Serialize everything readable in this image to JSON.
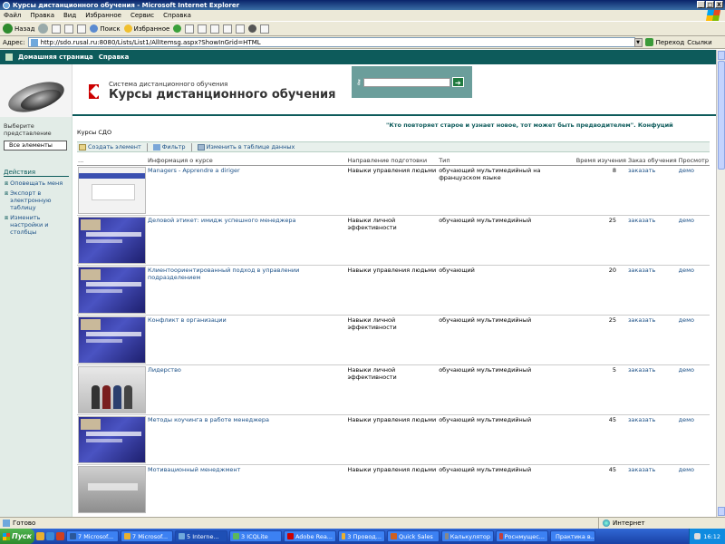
{
  "window": {
    "title": "Курсы дистанционного обучения - Microsoft Internet Explorer",
    "minimize": "_",
    "maximize": "□",
    "close": "X"
  },
  "menubar": [
    "Файл",
    "Правка",
    "Вид",
    "Избранное",
    "Сервис",
    "Справка"
  ],
  "toolbar": {
    "back": "Назад",
    "search": "Поиск",
    "favorites": "Избранное"
  },
  "addressbar": {
    "label": "Адрес:",
    "url": "http://sdo.rusal.ru:8080/Lists/List1/AllItemsg.aspx?ShowInGrid=HTML",
    "go": "Переход",
    "links": "Ссылки"
  },
  "sp": {
    "home": "Домашняя страница",
    "help": "Справка",
    "site_small": "Система дистанционного обучения",
    "site_big": "Курсы дистанционного обучения",
    "search_go": "➔",
    "quote": "\"Кто повторяет старое и узнает новое, тот может быть предводителем\". Конфуций"
  },
  "leftnav": {
    "choose_view": "Выберите представление",
    "current_view": "Все элементы",
    "actions_header": "Действия",
    "actions": [
      "Оповещать меня",
      "Экспорт в электронную таблицу",
      "Изменить настройки и столбцы"
    ]
  },
  "list": {
    "title": "Курсы СДО",
    "toolbar": {
      "new_item": "Создать элемент",
      "filter": "Фильтр",
      "edit_grid": "Изменить в таблице данных"
    },
    "headers": [
      "...",
      "Информация о курсе",
      "Направление подготовки",
      "Тип",
      "Время изучения",
      "Заказ обучения",
      "Просмотр"
    ],
    "rows": [
      {
        "thumb": "white",
        "name": "Managers - Apprendre a diriger",
        "direction": "Навыки управления людьми",
        "type": "обучающий мультимедийный на французском языке",
        "time": "8",
        "order": "заказать",
        "view": "демо"
      },
      {
        "thumb": "blue",
        "name": "Деловой этикет: имидж успешного менеджера",
        "direction": "Навыки личной эффективности",
        "type": "обучающий мультимедийный",
        "time": "25",
        "order": "заказать",
        "view": "демо"
      },
      {
        "thumb": "blue",
        "name": "Клиентоориентированный подход в управлении подразделением",
        "direction": "Навыки управления людьми",
        "type": "обучающий",
        "time": "20",
        "order": "заказать",
        "view": "демо"
      },
      {
        "thumb": "blue",
        "name": "Конфликт в организации",
        "direction": "Навыки личной эффективности",
        "type": "обучающий мультимедийный",
        "time": "25",
        "order": "заказать",
        "view": "демо"
      },
      {
        "thumb": "people",
        "name": "Лидерство",
        "direction": "Навыки личной эффективности",
        "type": "обучающий мультимедийный",
        "time": "5",
        "order": "заказать",
        "view": "демо"
      },
      {
        "thumb": "blue",
        "name": "Методы коучинга в работе менеджера",
        "direction": "Навыки управления людьми",
        "type": "обучающий мультимедийный",
        "time": "45",
        "order": "заказать",
        "view": "демо"
      },
      {
        "thumb": "gray",
        "name": "Мотивационный менеджмент",
        "direction": "Навыки управления людьми",
        "type": "обучающий мультимедийный",
        "time": "45",
        "order": "заказать",
        "view": "демо"
      }
    ]
  },
  "statusbar": {
    "left": "Готово",
    "zone": "Интернет"
  },
  "taskbar": {
    "start": "Пуск",
    "tasks": [
      "7 Microsof...",
      "7 Microsof...",
      "5 Interne...",
      "3 ICQLite",
      "Adobe Rea...",
      "3 Провод...",
      "Quick Sales",
      "Калькулятор",
      "Роснмущес...",
      "Практика в..."
    ],
    "clock": "16:12"
  }
}
